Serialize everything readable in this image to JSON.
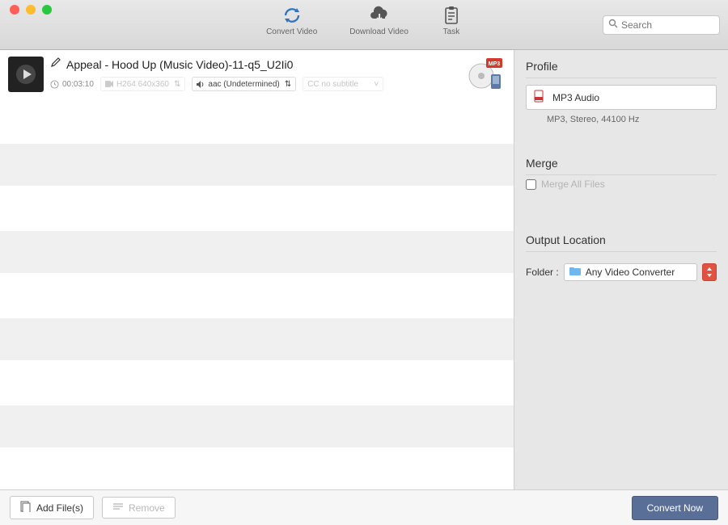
{
  "toolbar": {
    "convert_label": "Convert Video",
    "download_label": "Download Video",
    "task_label": "Task",
    "search_placeholder": "Search"
  },
  "item": {
    "title": "Appeal - Hood Up (Music Video)-11-q5_U2Ii0",
    "duration": "00:03:10",
    "video_codec": "H264 640x360",
    "audio_label": "aac (Undetermined)",
    "subtitle_label": "CC no subtitle",
    "format_badge": "MP3"
  },
  "sidebar": {
    "profile_title": "Profile",
    "profile_value": "MP3 Audio",
    "profile_desc": "MP3, Stereo, 44100 Hz",
    "merge_title": "Merge",
    "merge_label": "Merge All Files",
    "output_title": "Output Location",
    "folder_label": "Folder :",
    "folder_value": "Any Video Converter"
  },
  "footer": {
    "add_label": "Add File(s)",
    "remove_label": "Remove",
    "convert_label": "Convert Now"
  }
}
